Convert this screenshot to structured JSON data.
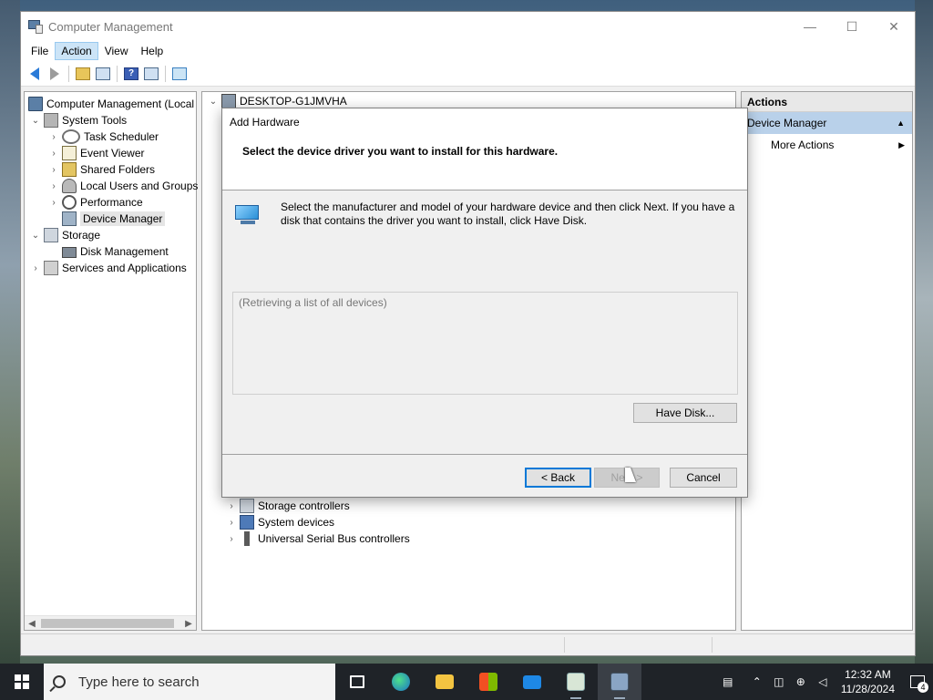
{
  "window": {
    "title": "Computer Management",
    "controls": {
      "minimize": "—",
      "maximize": "☐",
      "close": "✕"
    }
  },
  "menu": [
    "File",
    "Action",
    "View",
    "Help"
  ],
  "tree": {
    "root": "Computer Management (Local",
    "system_tools": "System Tools",
    "task_scheduler": "Task Scheduler",
    "event_viewer": "Event Viewer",
    "shared_folders": "Shared Folders",
    "local_users": "Local Users and Groups",
    "performance": "Performance",
    "device_manager": "Device Manager",
    "storage": "Storage",
    "disk_management": "Disk Management",
    "services_apps": "Services and Applications"
  },
  "center": {
    "computer": "DESKTOP-G1JMVHA",
    "partial_item": "Storage controllers",
    "system_devices": "System devices",
    "usb": "Universal Serial Bus controllers"
  },
  "actions": {
    "header": "Actions",
    "section": "Device Manager",
    "more": "More Actions"
  },
  "dialog": {
    "title": "Add Hardware",
    "heading": "Select the device driver you want to install for this hardware.",
    "instructions": "Select the manufacturer and model of your hardware device and then click Next. If you have a disk that contains the driver you want to install, click Have Disk.",
    "list_status": "(Retrieving a list of all devices)",
    "have_disk": "Have Disk...",
    "back": "< Back",
    "next": "Next >",
    "cancel": "Cancel"
  },
  "taskbar": {
    "search_placeholder": "Type here to search",
    "time": "12:32 AM",
    "date": "11/28/2024",
    "notifications": "4"
  }
}
